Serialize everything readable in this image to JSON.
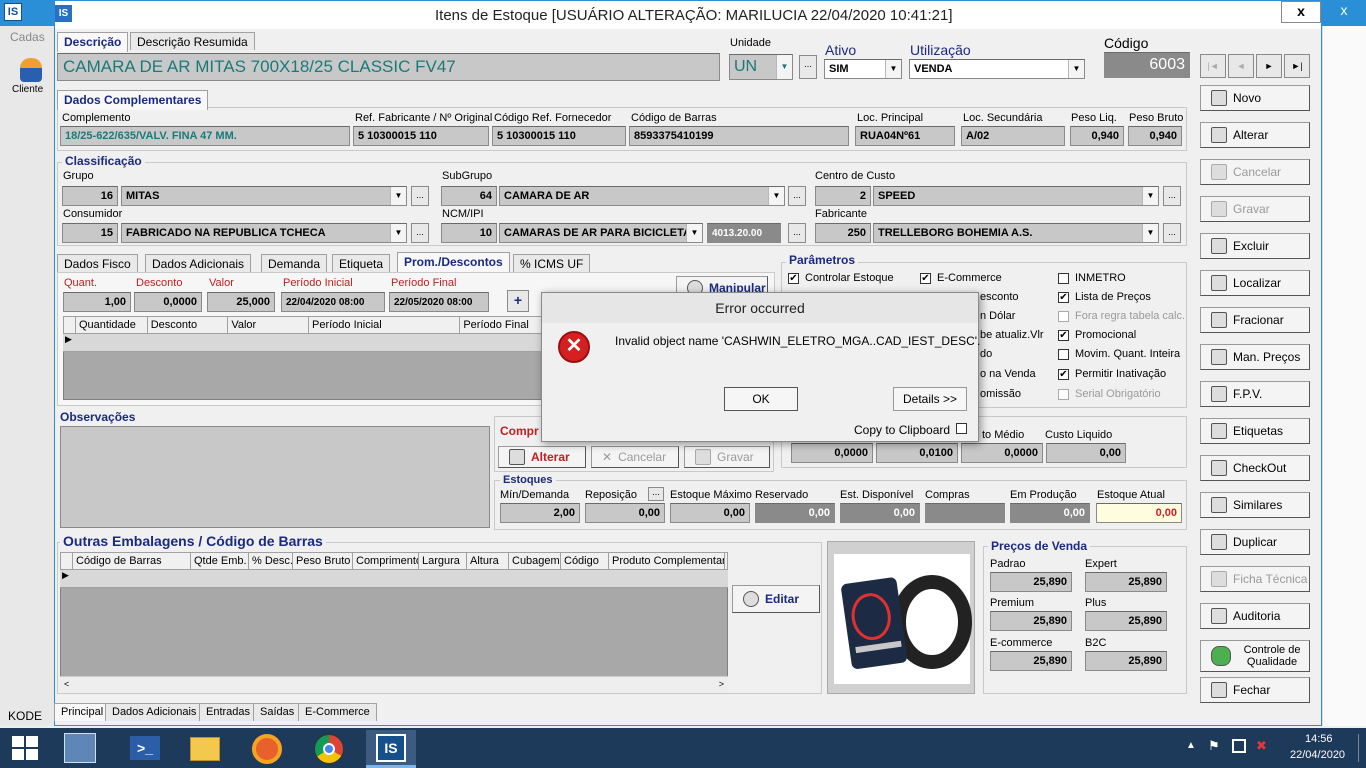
{
  "window": {
    "title": "Itens de Estoque  [USUÁRIO ALTERAÇÃO: MARILUCIA 22/04/2020 10:41:21]",
    "close": "x",
    "outer_close": "x"
  },
  "bg": {
    "cadas": "Cadas",
    "clientes": "Cliente",
    "kode": "KODE"
  },
  "top_tabs": [
    "Descrição",
    "Descrição Resumida"
  ],
  "descricao": "CAMARA DE AR MITAS 700X18/25 CLASSIC FV47",
  "unidade": {
    "label": "Unidade",
    "value": "UN"
  },
  "ativo": {
    "label": "Ativo",
    "value": "SIM"
  },
  "utilizacao": {
    "label": "Utilização",
    "value": "VENDA"
  },
  "codigo": {
    "label": "Código",
    "value": "6003"
  },
  "nav": [
    "|◄",
    "◄",
    "►",
    "►|"
  ],
  "dc": {
    "tab": "Dados Complementares",
    "complemento_l": "Complemento",
    "complemento": "18/25-622/635/VALV. FINA 47 MM.",
    "ref_fab_l": "Ref. Fabricante / Nº Original",
    "ref_fab": "5 10300015 110",
    "cod_forn_l": "Código Ref. Fornecedor",
    "cod_forn": "5 10300015 110",
    "barras_l": "Código de Barras",
    "barras": "8593375410199",
    "loc_p_l": "Loc. Principal",
    "loc_p": "RUA04Nº61",
    "loc_s_l": "Loc. Secundária",
    "loc_s": "A/02",
    "peso_l_l": "Peso Liq.",
    "peso_l": "0,940",
    "peso_b_l": "Peso Bruto",
    "peso_b": "0,940"
  },
  "cl": {
    "title": "Classificação",
    "grupo_l": "Grupo",
    "grupo_c": "16",
    "grupo": "MITAS",
    "sub_l": "SubGrupo",
    "sub_c": "64",
    "sub": "CAMARA DE AR",
    "cc_l": "Centro de Custo",
    "cc_c": "2",
    "cc": "SPEED",
    "cons_l": "Consumidor",
    "cons_c": "15",
    "cons": "FABRICADO NA REPUBLICA TCHECA",
    "ncm_l": "NCM/IPI",
    "ncm_c": "10",
    "ncm": "CAMARAS DE AR PARA BICICLETA",
    "ncm_code": "4013.20.00",
    "fab_l": "Fabricante",
    "fab_c": "250",
    "fab": "TRELLEBORG BOHEMIA A.S."
  },
  "mid_tabs": [
    "Dados Fisco",
    "Dados Adicionais",
    "Demanda",
    "Etiqueta",
    "Prom./Descontos",
    "% ICMS UF"
  ],
  "promo": {
    "q_l": "Quant.",
    "q": "1,00",
    "d_l": "Desconto",
    "d": "0,0000",
    "v_l": "Valor",
    "v": "25,000",
    "pi_l": "Período Inicial",
    "pi": "22/04/2020 08:00",
    "pf_l": "Período Final",
    "pf": "22/05/2020 08:00",
    "plus": "+",
    "manip": "Manipular",
    "cols": [
      "Quantidade",
      "Desconto",
      "Valor",
      "Período Inicial",
      "Período Final"
    ]
  },
  "params": {
    "title": "Parâmetros",
    "items": [
      {
        "t": "Controlar Estoque",
        "c": "✔"
      },
      {
        "t": "E-Commerce",
        "c": "✔"
      },
      {
        "t": "INMETRO",
        "c": ""
      },
      {
        "t": "esconto",
        "c": ""
      },
      {
        "t": "Lista de Preços",
        "c": "✔"
      },
      {
        "t": "n Dólar",
        "c": ""
      },
      {
        "t": "Fora regra tabela calc.",
        "c": ""
      },
      {
        "t": "be atualiz.Vlr",
        "c": ""
      },
      {
        "t": "Promocional",
        "c": "✔"
      },
      {
        "t": "do",
        "c": ""
      },
      {
        "t": "Movim. Quant. Inteira",
        "c": ""
      },
      {
        "t": "o na Venda",
        "c": ""
      },
      {
        "t": "Permitir Inativação",
        "c": "✔"
      },
      {
        "t": "omissão",
        "c": ""
      },
      {
        "t": "Serial Obrigatório",
        "c": ""
      }
    ]
  },
  "obs": {
    "title": "Observações"
  },
  "compr": {
    "title": "Compr",
    "alterar": "Alterar",
    "cancelar": "Cancelar",
    "gravar": "Gravar"
  },
  "custos": {
    "medio_l": "to Médio",
    "liq_l": "Custo Liquido",
    "v1": "0,0000",
    "v2": "0,0100",
    "v3": "0,0000",
    "v4": "0,00"
  },
  "estoques": {
    "title": "Estoques",
    "min_l": "Mín/Demanda",
    "min": "2,00",
    "rep_l": "Reposição",
    "rep": "0,00",
    "max_l": "Estoque Máximo",
    "max": "0,00",
    "res_l": "Reservado",
    "res": "0,00",
    "disp_l": "Est. Disponível",
    "disp": "0,00",
    "comp_l": "Compras",
    "comp": "",
    "prod_l": "Em Produção",
    "prod": "0,00",
    "atual_l": "Estoque Atual",
    "atual": "0,00"
  },
  "emb": {
    "title": "Outras Embalagens / Código de Barras",
    "cols": [
      "Código de Barras",
      "Qtde Emb.",
      "% Desc.",
      "Peso Bruto",
      "Comprimento",
      "Largura",
      "Altura",
      "Cubagem",
      "Código",
      "Produto Complementar"
    ],
    "editar": "Editar"
  },
  "precos": {
    "title": "Preços de Venda",
    "items": [
      {
        "l": "Padrao",
        "v": "25,890"
      },
      {
        "l": "Expert",
        "v": "25,890"
      },
      {
        "l": "Premium",
        "v": "25,890"
      },
      {
        "l": "Plus",
        "v": "25,890"
      },
      {
        "l": "E-commerce",
        "v": "25,890"
      },
      {
        "l": "B2C",
        "v": "25,890"
      }
    ]
  },
  "bottom_tabs": [
    "Principal",
    "Dados Adicionais",
    "Entradas",
    "Saídas",
    "E-Commerce"
  ],
  "side": [
    {
      "t": "Novo",
      "d": false,
      "i": "new-icon"
    },
    {
      "t": "Alterar",
      "d": false,
      "i": "edit-icon"
    },
    {
      "t": "Cancelar",
      "d": true,
      "i": "cancel-icon"
    },
    {
      "t": "Gravar",
      "d": true,
      "i": "save-icon"
    },
    {
      "t": "Excluir",
      "d": false,
      "i": "trash-icon"
    },
    {
      "t": "Localizar",
      "d": false,
      "i": "search-icon"
    },
    {
      "t": "Fracionar",
      "d": false,
      "i": "split-icon"
    },
    {
      "t": "Man. Preços",
      "d": false,
      "i": "price-icon"
    },
    {
      "t": "F.P.V.",
      "d": false,
      "i": "tools-icon"
    },
    {
      "t": "Etiquetas",
      "d": false,
      "i": "label-icon"
    },
    {
      "t": "CheckOut",
      "d": false,
      "i": "checkout-icon"
    },
    {
      "t": "Similares",
      "d": false,
      "i": "similar-icon"
    },
    {
      "t": "Duplicar",
      "d": false,
      "i": "duplicate-icon"
    },
    {
      "t": "Ficha Técnica",
      "d": true,
      "i": "sheet-icon"
    },
    {
      "t": "Auditoria",
      "d": false,
      "i": "audit-icon"
    },
    {
      "t": "Controle de Qualidade",
      "d": false,
      "i": "quality-icon"
    },
    {
      "t": "Fechar",
      "d": false,
      "i": "exit-icon"
    }
  ],
  "dialog": {
    "title": "Error occurred",
    "msg": "Invalid object name 'CASHWIN_ELETRO_MGA..CAD_IEST_DESC'.",
    "ok": "OK",
    "details": "Details >>",
    "clip": "Copy to Clipboard"
  },
  "taskbar": {
    "time": "14:56",
    "date": "22/04/2020",
    "app": "IS"
  },
  "colors": {
    "titlebar": "#2b8fd8",
    "accent": "#1a2a80",
    "teal": "#1a7a7a",
    "error": "#d42020"
  }
}
